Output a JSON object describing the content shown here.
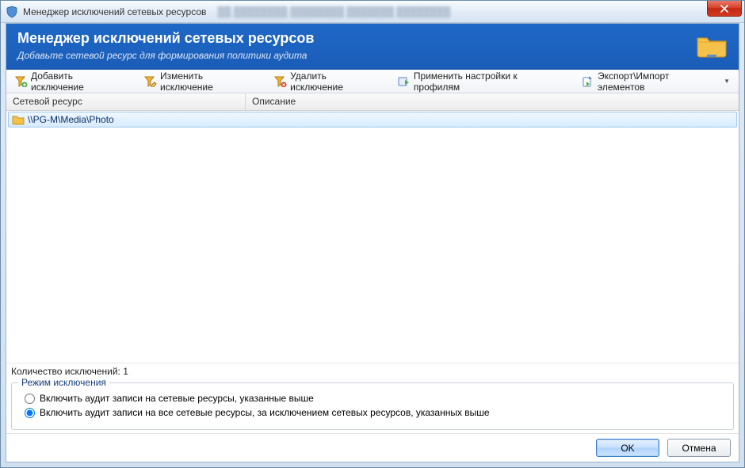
{
  "window": {
    "title": "Менеджер исключений сетевых ресурсов",
    "blurred_hint": "██ ████████ ████████ ███████ ████████"
  },
  "banner": {
    "title": "Менеджер исключений сетевых ресурсов",
    "subtitle": "Добавьте сетевой ресурс для формирования политики аудита"
  },
  "toolbar": {
    "add": "Добавить исключение",
    "edit": "Изменить исключение",
    "delete": "Удалить исключение",
    "apply": "Применить настройки к профилям",
    "export": "Экспорт\\Импорт элементов"
  },
  "grid": {
    "col1": "Сетевой ресурс",
    "col2": "Описание",
    "rows": [
      {
        "path": "\\\\PG-M\\Media\\Photo",
        "desc": ""
      }
    ]
  },
  "count": {
    "label": "Количество исключений:",
    "value": "1"
  },
  "mode": {
    "legend": "Режим исключения",
    "opt1": "Включить аудит записи на сетевые ресурсы, указанные выше",
    "opt2": "Включить аудит записи на все сетевые ресурсы, за исключением сетевых ресурсов, указанных выше"
  },
  "buttons": {
    "ok": "OK",
    "cancel": "Отмена"
  }
}
